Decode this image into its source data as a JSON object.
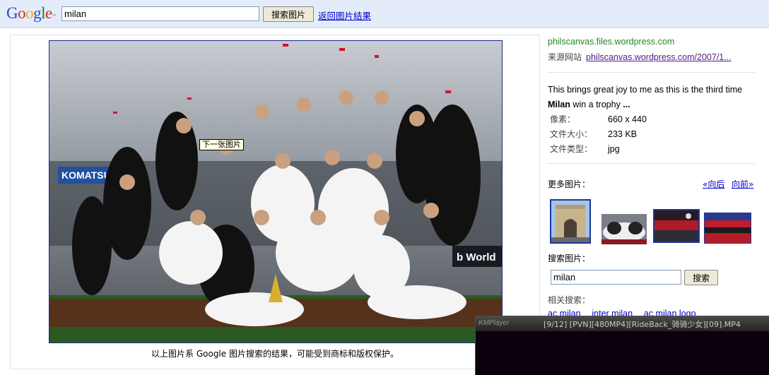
{
  "header": {
    "logo_text": "Google",
    "search_value": "milan",
    "search_button": "搜索图片",
    "back_link": "返回图片结果"
  },
  "image": {
    "tooltip": "下一张图片",
    "caption": "以上图片系 Google 图片搜索的结果，可能受到商标和版权保护。"
  },
  "details": {
    "domain": "philscanvas.files.wordpress.com",
    "source_label": "来源网站",
    "source_url": "philscanvas.wordpress.com/2007/1...",
    "snippet_pre": "This brings great joy to me as this is the third time ",
    "snippet_bold": "Milan",
    "snippet_post": " win a trophy ",
    "snippet_ellipsis": "...",
    "meta": [
      {
        "key": "像素：",
        "value": "660 x 440"
      },
      {
        "key": "文件大小：",
        "value": "233 KB"
      },
      {
        "key": "文件类型：",
        "value": "jpg"
      }
    ]
  },
  "more": {
    "label": "更多图片：",
    "prev": "«向后",
    "next": "向前»"
  },
  "side_search": {
    "label": "搜索图片：",
    "value": "milan",
    "button": "搜索"
  },
  "related": {
    "label": "相关搜索：",
    "links": [
      "ac milan",
      "inter milan",
      "ac milan logo"
    ]
  },
  "kmplayer": {
    "logo": "KMPlayer",
    "title": "[9/12] [PVN][480MP4][RideBack_骑骑少女][09].MP4"
  },
  "colors": {
    "topbar": "#e5ecf9",
    "link": "#0000cc",
    "visited": "#551a8b",
    "domain_green": "#228822"
  }
}
